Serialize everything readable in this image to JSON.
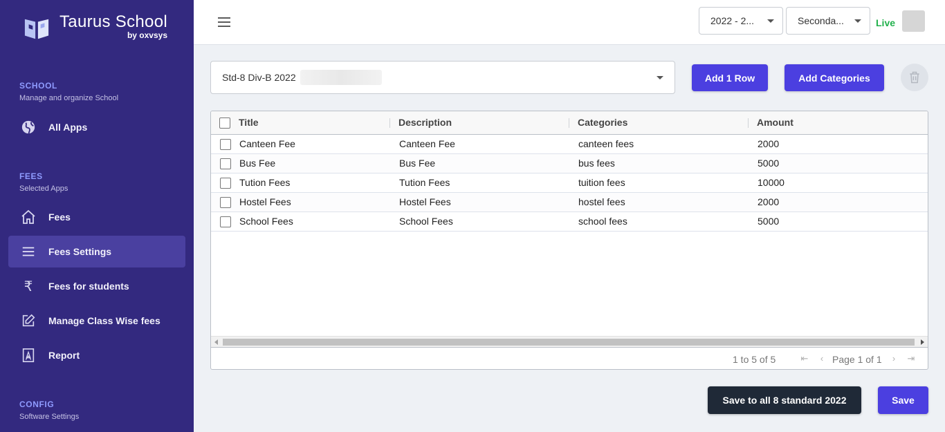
{
  "brand": {
    "name": "Taurus School",
    "by": "by oxvsys"
  },
  "sidebar": {
    "sections": [
      {
        "title": "SCHOOL",
        "subtitle": "Manage and organize School"
      },
      {
        "title": "FEES",
        "subtitle": "Selected Apps"
      },
      {
        "title": "CONFIG",
        "subtitle": "Software Settings"
      }
    ],
    "items": [
      {
        "label": "All Apps",
        "icon": "globe-icon"
      },
      {
        "label": "Fees",
        "icon": "home-icon"
      },
      {
        "label": "Fees Settings",
        "icon": "menu-icon",
        "active": true
      },
      {
        "label": "Fees for students",
        "icon": "rupee-icon"
      },
      {
        "label": "Manage Class Wise fees",
        "icon": "edit-icon"
      },
      {
        "label": "Report",
        "icon": "pdf-icon"
      }
    ]
  },
  "topbar": {
    "year_select": "2022 - 2...",
    "section_select": "Seconda...",
    "live_label": "Live"
  },
  "class_select": {
    "value": "Std-8 Div-B 2022"
  },
  "actions": {
    "add_row": "Add 1 Row",
    "add_categories": "Add Categories",
    "save_all": "Save to all 8 standard 2022",
    "save": "Save"
  },
  "grid": {
    "columns": [
      "Title",
      "Description",
      "Categories",
      "Amount"
    ],
    "rows": [
      [
        "Canteen Fee",
        "Canteen Fee",
        "canteen fees",
        "2000"
      ],
      [
        "Bus Fee",
        "Bus Fee",
        "bus fees",
        "5000"
      ],
      [
        "Tution Fees",
        "Tution Fees",
        "tuition fees",
        "10000"
      ],
      [
        "Hostel Fees",
        "Hostel Fees",
        "hostel fees",
        "2000"
      ],
      [
        "School Fees",
        "School Fees",
        "school fees",
        "5000"
      ]
    ],
    "summary": "1 to 5 of 5",
    "page_text": "Page 1 of 1"
  },
  "colors": {
    "sidebar": "#33297f",
    "primary": "#4b3fe0",
    "live": "#22b14c",
    "dark_button": "#1f2937"
  }
}
